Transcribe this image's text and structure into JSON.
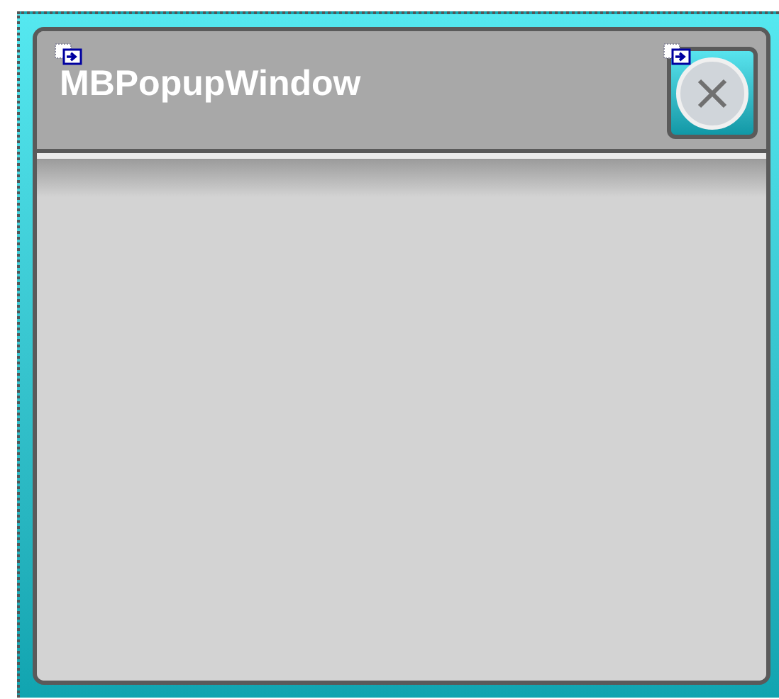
{
  "window": {
    "title": "MBPopupWindow"
  }
}
